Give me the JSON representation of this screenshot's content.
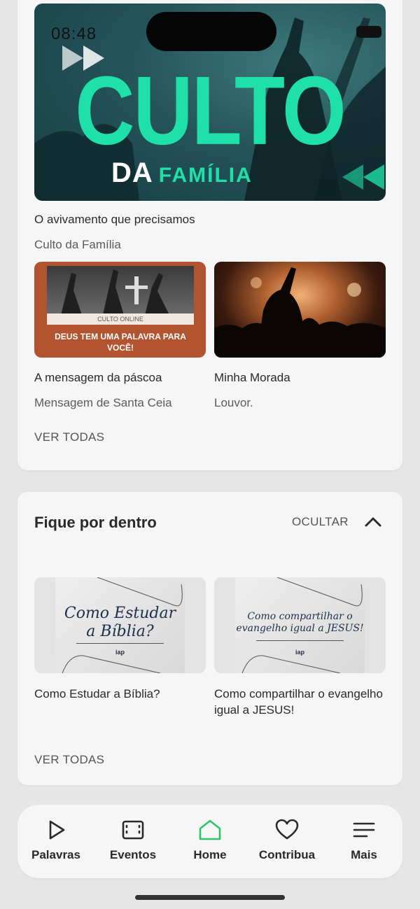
{
  "colors": {
    "accent": "#1fe0a8",
    "home_active": "#2ec36b",
    "card_bg": "#f6f6f6",
    "page_bg": "#e6e6e6"
  },
  "featured": {
    "image": {
      "time": "08:48",
      "title": "CULTO",
      "sub_a": "DA",
      "sub_b": "FAMÍLIA"
    },
    "title": "O avivamento que precisamos",
    "subtitle": "Culto da Família"
  },
  "grid": [
    {
      "image": {
        "tag": "CULTO ONLINE",
        "message": "DEUS TEM UMA PALAVRA PARA VOCÊ!"
      },
      "title": "A mensagem da páscoa",
      "subtitle": "Mensagem de Santa Ceia"
    },
    {
      "title": "Minha Morada",
      "subtitle": "Louvor."
    }
  ],
  "section1": {
    "see_all": "VER TODAS"
  },
  "section2": {
    "title": "Fique por dentro",
    "toggle": "OCULTAR",
    "toggle_icon": "chevron-up-icon",
    "posts": [
      {
        "image_text": [
          "Como Estudar",
          "a Bíblia?"
        ],
        "logo": "iap",
        "title": "Como Estudar a Bíblia?"
      },
      {
        "image_text": [
          "Como compartilhar o",
          "evangelho igual a JESUS!"
        ],
        "logo": "iap",
        "title": "Como compartilhar o evangelho igual a JESUS!"
      }
    ],
    "see_all": "VER TODAS"
  },
  "tabbar": [
    {
      "label": "Palavras",
      "icon": "play-icon"
    },
    {
      "label": "Eventos",
      "icon": "calendar-icon"
    },
    {
      "label": "Home",
      "icon": "home-icon",
      "active": true
    },
    {
      "label": "Contribua",
      "icon": "heart-icon"
    },
    {
      "label": "Mais",
      "icon": "menu-icon"
    }
  ]
}
